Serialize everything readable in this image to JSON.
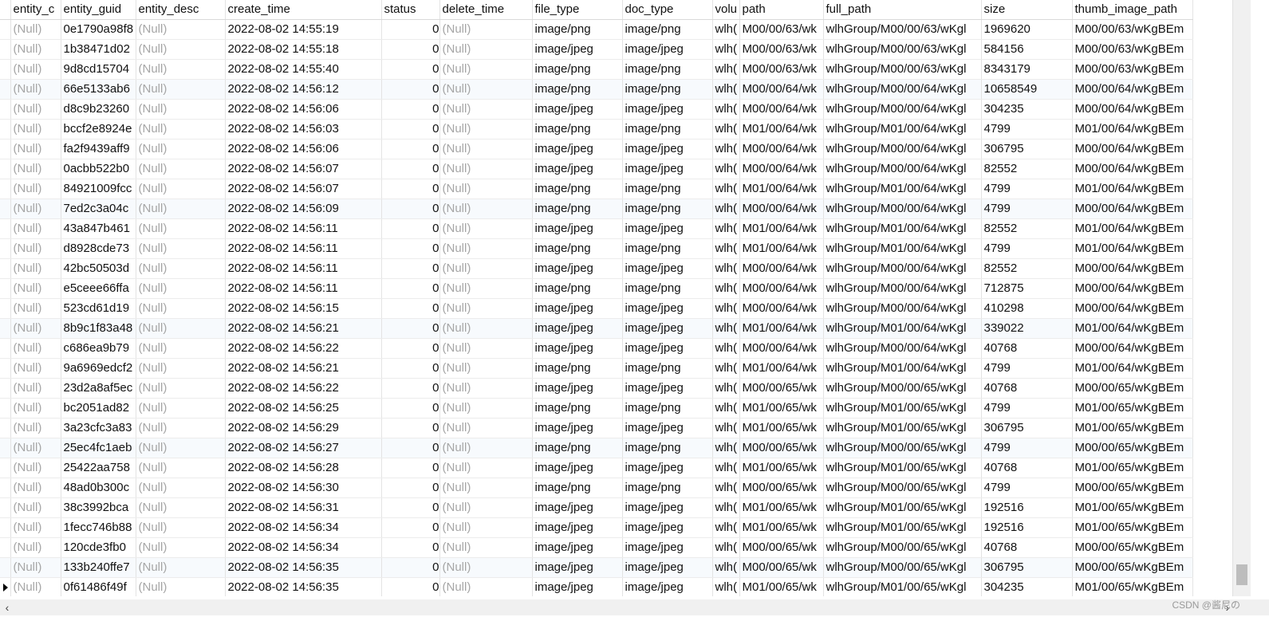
{
  "columns": [
    "entity_c",
    "entity_guid",
    "entity_desc",
    "create_time",
    "status",
    "delete_time",
    "file_type",
    "doc_type",
    "volu",
    "path",
    "full_path",
    "size",
    "thumb_image_path"
  ],
  "rows": [
    [
      "(Null)",
      "0e1790a98f8",
      "(Null)",
      "2022-08-02 14:55:19",
      "0",
      "(Null)",
      "image/png",
      "image/png",
      "wlh(",
      "M00/00/63/wk",
      "wlhGroup/M00/00/63/wKgl",
      "1969620",
      "M00/00/63/wKgBEm"
    ],
    [
      "(Null)",
      "1b38471d02",
      "(Null)",
      "2022-08-02 14:55:18",
      "0",
      "(Null)",
      "image/jpeg",
      "image/jpeg",
      "wlh(",
      "M00/00/63/wk",
      "wlhGroup/M00/00/63/wKgl",
      "584156",
      "M00/00/63/wKgBEm"
    ],
    [
      "(Null)",
      "9d8cd15704",
      "(Null)",
      "2022-08-02 14:55:40",
      "0",
      "(Null)",
      "image/png",
      "image/png",
      "wlh(",
      "M00/00/63/wk",
      "wlhGroup/M00/00/63/wKgl",
      "8343179",
      "M00/00/63/wKgBEm"
    ],
    [
      "(Null)",
      "66e5133ab6",
      "(Null)",
      "2022-08-02 14:56:12",
      "0",
      "(Null)",
      "image/png",
      "image/png",
      "wlh(",
      "M00/00/64/wk",
      "wlhGroup/M00/00/64/wKgl",
      "10658549",
      "M00/00/64/wKgBEm"
    ],
    [
      "(Null)",
      "d8c9b23260",
      "(Null)",
      "2022-08-02 14:56:06",
      "0",
      "(Null)",
      "image/jpeg",
      "image/jpeg",
      "wlh(",
      "M00/00/64/wk",
      "wlhGroup/M00/00/64/wKgl",
      "304235",
      "M00/00/64/wKgBEm"
    ],
    [
      "(Null)",
      "bccf2e8924e",
      "(Null)",
      "2022-08-02 14:56:03",
      "0",
      "(Null)",
      "image/png",
      "image/png",
      "wlh(",
      "M01/00/64/wk",
      "wlhGroup/M01/00/64/wKgl",
      "4799",
      "M01/00/64/wKgBEm"
    ],
    [
      "(Null)",
      "fa2f9439aff9",
      "(Null)",
      "2022-08-02 14:56:06",
      "0",
      "(Null)",
      "image/jpeg",
      "image/jpeg",
      "wlh(",
      "M00/00/64/wk",
      "wlhGroup/M00/00/64/wKgl",
      "306795",
      "M00/00/64/wKgBEm"
    ],
    [
      "(Null)",
      "0acbb522b0",
      "(Null)",
      "2022-08-02 14:56:07",
      "0",
      "(Null)",
      "image/jpeg",
      "image/jpeg",
      "wlh(",
      "M00/00/64/wk",
      "wlhGroup/M00/00/64/wKgl",
      "82552",
      "M00/00/64/wKgBEm"
    ],
    [
      "(Null)",
      "84921009fcc",
      "(Null)",
      "2022-08-02 14:56:07",
      "0",
      "(Null)",
      "image/png",
      "image/png",
      "wlh(",
      "M01/00/64/wk",
      "wlhGroup/M01/00/64/wKgl",
      "4799",
      "M01/00/64/wKgBEm"
    ],
    [
      "(Null)",
      "7ed2c3a04c",
      "(Null)",
      "2022-08-02 14:56:09",
      "0",
      "(Null)",
      "image/png",
      "image/png",
      "wlh(",
      "M00/00/64/wk",
      "wlhGroup/M00/00/64/wKgl",
      "4799",
      "M00/00/64/wKgBEm"
    ],
    [
      "(Null)",
      "43a847b461",
      "(Null)",
      "2022-08-02 14:56:11",
      "0",
      "(Null)",
      "image/jpeg",
      "image/jpeg",
      "wlh(",
      "M01/00/64/wk",
      "wlhGroup/M01/00/64/wKgl",
      "82552",
      "M01/00/64/wKgBEm"
    ],
    [
      "(Null)",
      "d8928cde73",
      "(Null)",
      "2022-08-02 14:56:11",
      "0",
      "(Null)",
      "image/png",
      "image/png",
      "wlh(",
      "M01/00/64/wk",
      "wlhGroup/M01/00/64/wKgl",
      "4799",
      "M01/00/64/wKgBEm"
    ],
    [
      "(Null)",
      "42bc50503d",
      "(Null)",
      "2022-08-02 14:56:11",
      "0",
      "(Null)",
      "image/jpeg",
      "image/jpeg",
      "wlh(",
      "M00/00/64/wk",
      "wlhGroup/M00/00/64/wKgl",
      "82552",
      "M00/00/64/wKgBEm"
    ],
    [
      "(Null)",
      "e5ceee66ffa",
      "(Null)",
      "2022-08-02 14:56:11",
      "0",
      "(Null)",
      "image/png",
      "image/png",
      "wlh(",
      "M00/00/64/wk",
      "wlhGroup/M00/00/64/wKgl",
      "712875",
      "M00/00/64/wKgBEm"
    ],
    [
      "(Null)",
      "523cd61d19",
      "(Null)",
      "2022-08-02 14:56:15",
      "0",
      "(Null)",
      "image/jpeg",
      "image/jpeg",
      "wlh(",
      "M00/00/64/wk",
      "wlhGroup/M00/00/64/wKgl",
      "410298",
      "M00/00/64/wKgBEm"
    ],
    [
      "(Null)",
      "8b9c1f83a48",
      "(Null)",
      "2022-08-02 14:56:21",
      "0",
      "(Null)",
      "image/jpeg",
      "image/jpeg",
      "wlh(",
      "M01/00/64/wk",
      "wlhGroup/M01/00/64/wKgl",
      "339022",
      "M01/00/64/wKgBEm"
    ],
    [
      "(Null)",
      "c686ea9b79",
      "(Null)",
      "2022-08-02 14:56:22",
      "0",
      "(Null)",
      "image/jpeg",
      "image/jpeg",
      "wlh(",
      "M00/00/64/wk",
      "wlhGroup/M00/00/64/wKgl",
      "40768",
      "M00/00/64/wKgBEm"
    ],
    [
      "(Null)",
      "9a6969edcf2",
      "(Null)",
      "2022-08-02 14:56:21",
      "0",
      "(Null)",
      "image/png",
      "image/png",
      "wlh(",
      "M01/00/64/wk",
      "wlhGroup/M01/00/64/wKgl",
      "4799",
      "M01/00/64/wKgBEm"
    ],
    [
      "(Null)",
      "23d2a8af5ec",
      "(Null)",
      "2022-08-02 14:56:22",
      "0",
      "(Null)",
      "image/jpeg",
      "image/jpeg",
      "wlh(",
      "M00/00/65/wk",
      "wlhGroup/M00/00/65/wKgl",
      "40768",
      "M00/00/65/wKgBEm"
    ],
    [
      "(Null)",
      "bc2051ad82",
      "(Null)",
      "2022-08-02 14:56:25",
      "0",
      "(Null)",
      "image/png",
      "image/png",
      "wlh(",
      "M01/00/65/wk",
      "wlhGroup/M01/00/65/wKgl",
      "4799",
      "M01/00/65/wKgBEm"
    ],
    [
      "(Null)",
      "3a23cfc3a83",
      "(Null)",
      "2022-08-02 14:56:29",
      "0",
      "(Null)",
      "image/jpeg",
      "image/jpeg",
      "wlh(",
      "M01/00/65/wk",
      "wlhGroup/M01/00/65/wKgl",
      "306795",
      "M01/00/65/wKgBEm"
    ],
    [
      "(Null)",
      "25ec4fc1aeb",
      "(Null)",
      "2022-08-02 14:56:27",
      "0",
      "(Null)",
      "image/png",
      "image/png",
      "wlh(",
      "M00/00/65/wk",
      "wlhGroup/M00/00/65/wKgl",
      "4799",
      "M00/00/65/wKgBEm"
    ],
    [
      "(Null)",
      "25422aa758",
      "(Null)",
      "2022-08-02 14:56:28",
      "0",
      "(Null)",
      "image/jpeg",
      "image/jpeg",
      "wlh(",
      "M01/00/65/wk",
      "wlhGroup/M01/00/65/wKgl",
      "40768",
      "M01/00/65/wKgBEm"
    ],
    [
      "(Null)",
      "48ad0b300c",
      "(Null)",
      "2022-08-02 14:56:30",
      "0",
      "(Null)",
      "image/png",
      "image/png",
      "wlh(",
      "M00/00/65/wk",
      "wlhGroup/M00/00/65/wKgl",
      "4799",
      "M00/00/65/wKgBEm"
    ],
    [
      "(Null)",
      "38c3992bca",
      "(Null)",
      "2022-08-02 14:56:31",
      "0",
      "(Null)",
      "image/jpeg",
      "image/jpeg",
      "wlh(",
      "M01/00/65/wk",
      "wlhGroup/M01/00/65/wKgl",
      "192516",
      "M01/00/65/wKgBEm"
    ],
    [
      "(Null)",
      "1fecc746b88",
      "(Null)",
      "2022-08-02 14:56:34",
      "0",
      "(Null)",
      "image/jpeg",
      "image/jpeg",
      "wlh(",
      "M01/00/65/wk",
      "wlhGroup/M01/00/65/wKgl",
      "192516",
      "M01/00/65/wKgBEm"
    ],
    [
      "(Null)",
      "120cde3fb0",
      "(Null)",
      "2022-08-02 14:56:34",
      "0",
      "(Null)",
      "image/jpeg",
      "image/jpeg",
      "wlh(",
      "M00/00/65/wk",
      "wlhGroup/M00/00/65/wKgl",
      "40768",
      "M00/00/65/wKgBEm"
    ],
    [
      "(Null)",
      "133b240ffe7",
      "(Null)",
      "2022-08-02 14:56:35",
      "0",
      "(Null)",
      "image/jpeg",
      "image/jpeg",
      "wlh(",
      "M00/00/65/wk",
      "wlhGroup/M00/00/65/wKgl",
      "306795",
      "M00/00/65/wKgBEm"
    ],
    [
      "(Null)",
      "0f61486f49f",
      "(Null)",
      "2022-08-02 14:56:35",
      "0",
      "(Null)",
      "image/jpeg",
      "image/jpeg",
      "wlh(",
      "M01/00/65/wk",
      "wlhGroup/M01/00/65/wKgl",
      "304235",
      "M01/00/65/wKgBEm"
    ]
  ],
  "selected_row": 28,
  "watermark": "CSDN @酱尼の",
  "colors": {
    "null_text": "#a6a6a6",
    "grid_line": "#e3e3e3",
    "scrollbar": "#f0f0f0"
  }
}
